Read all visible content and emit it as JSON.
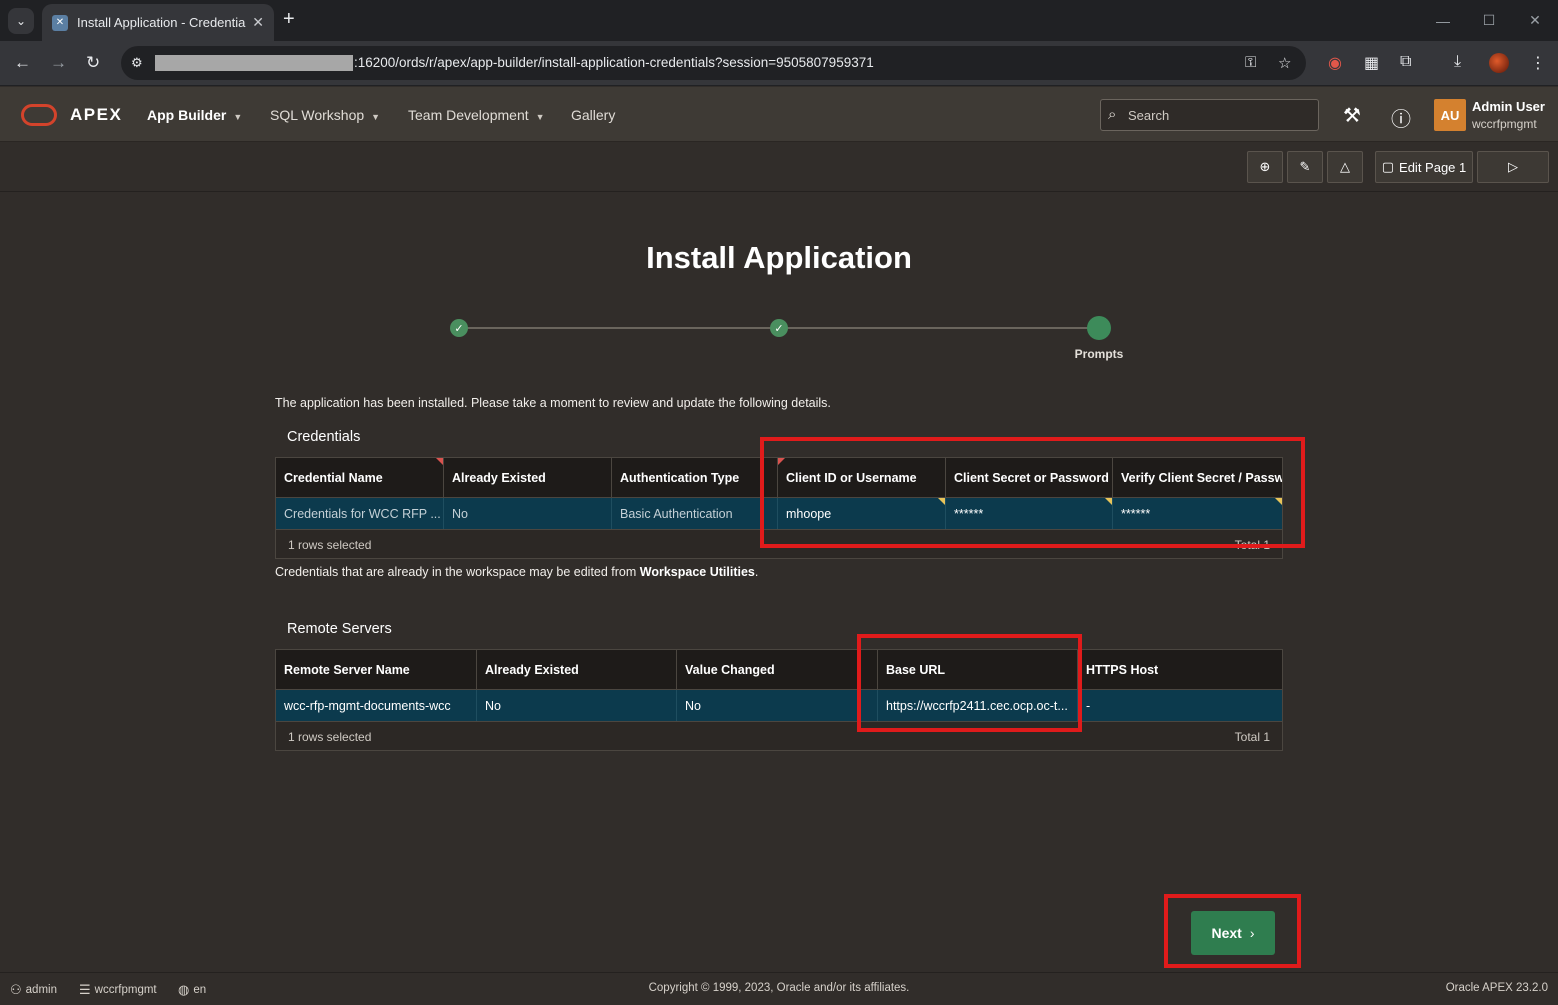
{
  "browser": {
    "tab_title": "Install Application - Credentials",
    "url": ":16200/ords/r/apex/app-builder/install-application-credentials?session=9505807959371"
  },
  "header": {
    "brand": "APEX",
    "nav": [
      "App Builder",
      "SQL Workshop",
      "Team Development",
      "Gallery"
    ],
    "search_placeholder": "Search",
    "user_initials": "AU",
    "user_name": "Admin User",
    "user_workspace": "wccrfpmgmt"
  },
  "toolbar": {
    "edit_page_label": "Edit Page 1"
  },
  "wizard": {
    "title": "Install Application",
    "current_step_label": "Prompts"
  },
  "intro_text": "The application has been installed. Please take a moment to review and update the following details.",
  "credentials": {
    "section_title": "Credentials",
    "columns": [
      "Credential Name",
      "Already Existed",
      "Authentication Type",
      "Client ID or Username",
      "Client Secret or Password",
      "Verify Client Secret / Passwo"
    ],
    "row": [
      "Credentials for WCC RFP ...",
      "No",
      "Basic Authentication",
      "mhoope",
      "******",
      "******"
    ],
    "rows_selected": "1 rows selected",
    "total": "Total 1",
    "note_prefix": "Credentials that are already in the workspace may be edited from ",
    "note_link": "Workspace Utilities",
    "note_suffix": "."
  },
  "remote_servers": {
    "section_title": "Remote Servers",
    "columns": [
      "Remote Server Name",
      "Already Existed",
      "Value Changed",
      "Base URL",
      "HTTPS Host"
    ],
    "row": [
      "wcc-rfp-mgmt-documents-wcc",
      "No",
      "No",
      "https://wccrfp2411.cec.ocp.oc-t...",
      "-"
    ],
    "rows_selected": "1 rows selected",
    "total": "Total 1"
  },
  "next_button": "Next",
  "footer": {
    "user": "admin",
    "workspace": "wccrfpmgmt",
    "language": "en",
    "copyright": "Copyright © 1999, 2023, Oracle and/or its affiliates.",
    "version": "Oracle APEX 23.2.0"
  },
  "colors": {
    "accent_green": "#2f7d4f",
    "highlight_red": "#e01b1b",
    "selected_row": "#0c3a4d",
    "oracle_red": "#d3432b"
  }
}
